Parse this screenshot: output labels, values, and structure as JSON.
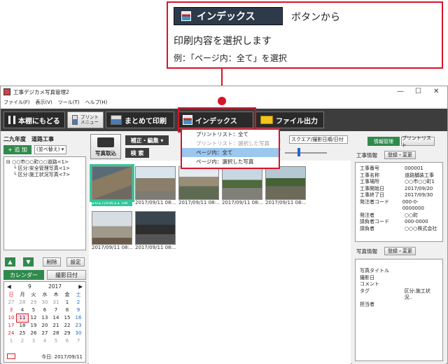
{
  "callout": {
    "button_label": "インデックス",
    "line1": "ボタンから",
    "line2": "印刷内容を選択します",
    "line3": "例：「ページ内：全て」を選択"
  },
  "window": {
    "title": "工事デジカメ写真管理2",
    "controls": [
      "—",
      "☐",
      "✕"
    ],
    "menu": [
      "ファイル(F)",
      "表示(V)",
      "ツール(T)",
      "ヘルプ(H)"
    ]
  },
  "toolbar": {
    "back_label": "本棚にもどる",
    "print_menu_label": "プリント\nメニュー",
    "batch_print_label": "まとめて印刷",
    "index_label": "インデックス",
    "file_output_label": "ファイル出力"
  },
  "dropdown": {
    "items": [
      {
        "label": "プリントリスト：全て",
        "state": "normal"
      },
      {
        "label": "プリントリスト：選択した写真",
        "state": "disabled"
      },
      {
        "label": "ページ内：全て",
        "state": "hover"
      },
      {
        "label": "ページ内：選択した写真",
        "state": "normal"
      }
    ]
  },
  "left": {
    "project_title": "二九年度　道路工事",
    "add_label": "追 加",
    "sort_label": "(並べ替え)",
    "tree": [
      "○○市○○町○○道路<1>",
      "区分:安全管理写真<1>",
      "区分:施工状況写真<7>"
    ],
    "delete_label": "削除",
    "settings_label": "設定",
    "calendar_tab": "カレンダー",
    "shoot_date_tab": "撮影日付",
    "calendar": {
      "month": "9",
      "year": "2017",
      "weekdays": [
        "日",
        "月",
        "火",
        "水",
        "木",
        "金",
        "土"
      ],
      "days": [
        "27",
        "28",
        "29",
        "30",
        "31",
        "1",
        "2",
        "3",
        "4",
        "5",
        "6",
        "7",
        "8",
        "9",
        "10",
        "11",
        "12",
        "13",
        "14",
        "15",
        "16",
        "17",
        "18",
        "19",
        "20",
        "21",
        "22",
        "23",
        "24",
        "25",
        "26",
        "27",
        "28",
        "29",
        "30",
        "1",
        "2",
        "3",
        "4",
        "5",
        "6",
        "7"
      ],
      "today_label": "今日: 2017/09/11"
    }
  },
  "center": {
    "photo_import_label": "写真取込",
    "edit_label": "補正・編集",
    "search_label": "検 索",
    "display_label": "示",
    "display_select": "スクエア/撮影日順/日付",
    "size_label": "ズ",
    "photos": [
      {
        "caption": "2017/09/11 08",
        "selected": true
      },
      {
        "caption": "2017/09/11 08:..",
        "selected": false
      },
      {
        "caption": "2017/09/11 08:..",
        "selected": false
      },
      {
        "caption": "2017/09/11 08:..",
        "selected": false
      },
      {
        "caption": "2017/09/11 08:..",
        "selected": false
      },
      {
        "caption": "2017/09/11 08:..",
        "selected": false
      },
      {
        "caption": "2017/09/11 08:..",
        "selected": false
      }
    ]
  },
  "right": {
    "tab_info": "情報管理",
    "tab_print": "プリントリスト",
    "work_info_title": "工事情報",
    "register_label": "登録・変更",
    "work_info": [
      {
        "k": "工事番号",
        "v": "000001"
      },
      {
        "k": "工事名称",
        "v": "道路舗装工事"
      },
      {
        "k": "工事場所",
        "v": "○○市○○町1"
      },
      {
        "k": "工事開始日",
        "v": "2017/09/20"
      },
      {
        "k": "工事終了日",
        "v": "2017/09/30"
      },
      {
        "k": "発注者コード",
        "v": "000-0-0000000"
      },
      {
        "k": "発注者",
        "v": "○○町"
      },
      {
        "k": "請負者コード",
        "v": "000-0000"
      },
      {
        "k": "請負者",
        "v": "○○○株式会社"
      }
    ],
    "photo_info_title": "写真情報",
    "photo_info": [
      {
        "k": "写真タイトル",
        "v": ""
      },
      {
        "k": "撮影日",
        "v": ""
      },
      {
        "k": "コメント",
        "v": ""
      },
      {
        "k": "タグ",
        "v": "区分:施工状況.."
      },
      {
        "k": "担当者",
        "v": ""
      }
    ]
  }
}
